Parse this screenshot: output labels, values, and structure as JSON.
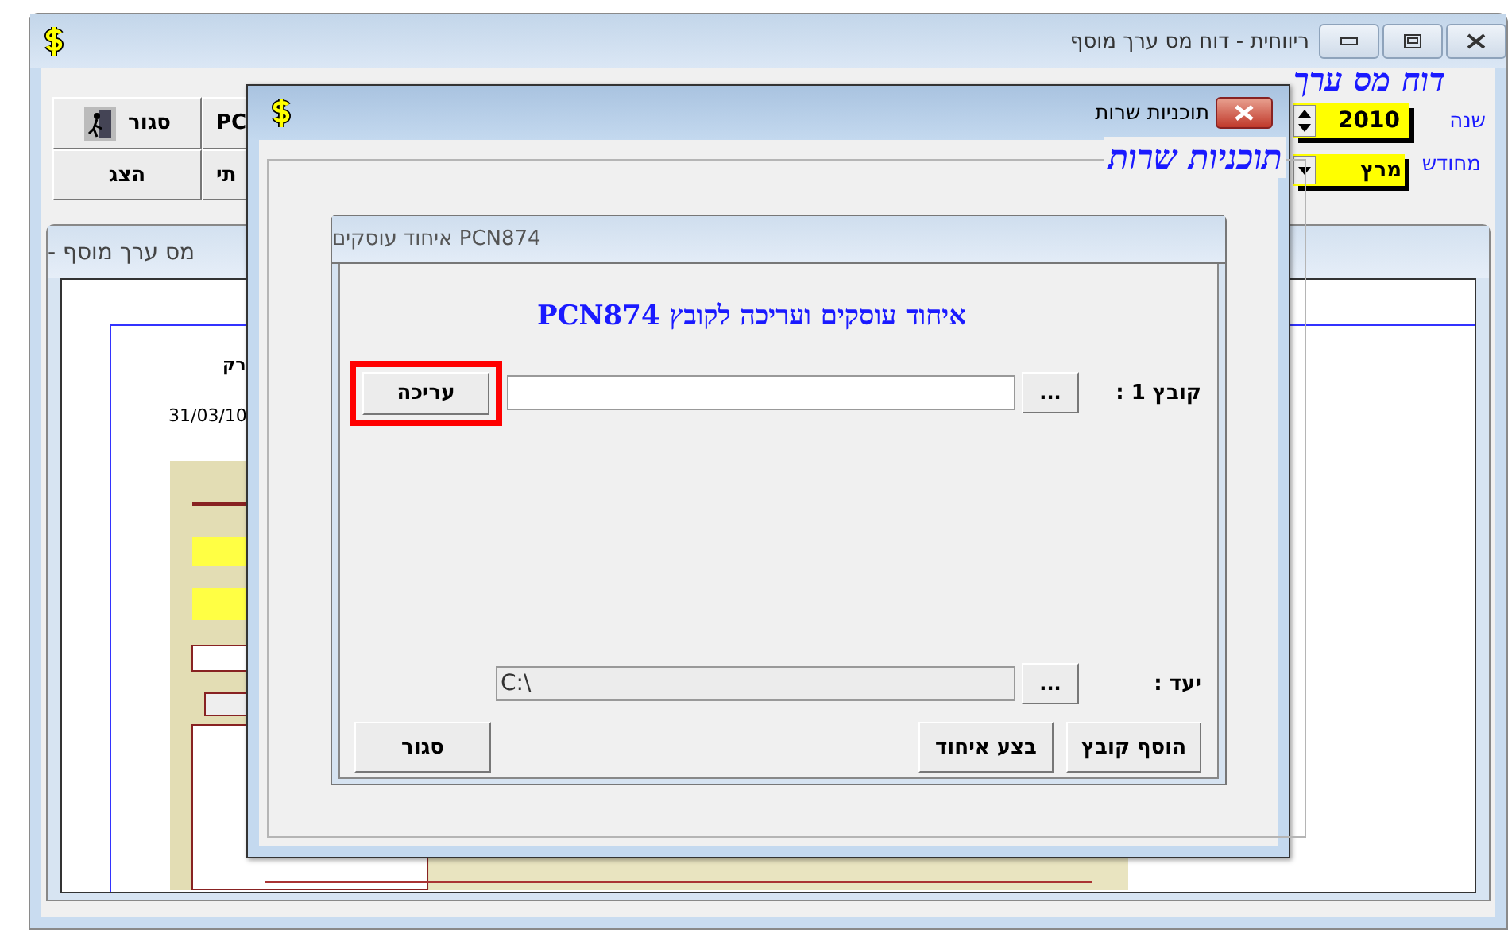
{
  "main_window": {
    "title": "ריווחית - דוח מס ערך מוסף",
    "toolbar_buttons": [
      {
        "label": "PC",
        "kind": "plain"
      },
      {
        "label": "סגור",
        "kind": "exit"
      },
      {
        "label": "תי",
        "kind": "plain"
      },
      {
        "label": "הצג",
        "kind": "plain"
      }
    ],
    "report_title": "דוח מס ערך",
    "year": {
      "label": "שנה",
      "value": "2010"
    },
    "month": {
      "label": "מחודש",
      "value": "מרץ"
    },
    "report_panel": {
      "title": "מס ערך מוסף -",
      "texts": [
        "רק",
        "31/03/10"
      ]
    }
  },
  "dialog": {
    "title": "תוכניות שרות",
    "group_title": "תוכניות שרות",
    "inner_window": {
      "title": "PCN874 איחוד עוסקים",
      "heading": "איחוד עוסקים ועריכה לקובץ PCN874",
      "rows": [
        {
          "label": "קובץ 1 :",
          "browse": "...",
          "disabled": false,
          "action": {
            "label": "עריכה",
            "highlighted": true
          }
        },
        {
          "label": "יעד :",
          "browse": "...",
          "value": "C:\\",
          "disabled": true
        }
      ],
      "buttons": [
        {
          "label": "הוסף קובץ",
          "kind": "action"
        },
        {
          "label": "בצע איחוד",
          "kind": "action"
        },
        {
          "label": "סגור",
          "kind": "close"
        }
      ]
    }
  }
}
